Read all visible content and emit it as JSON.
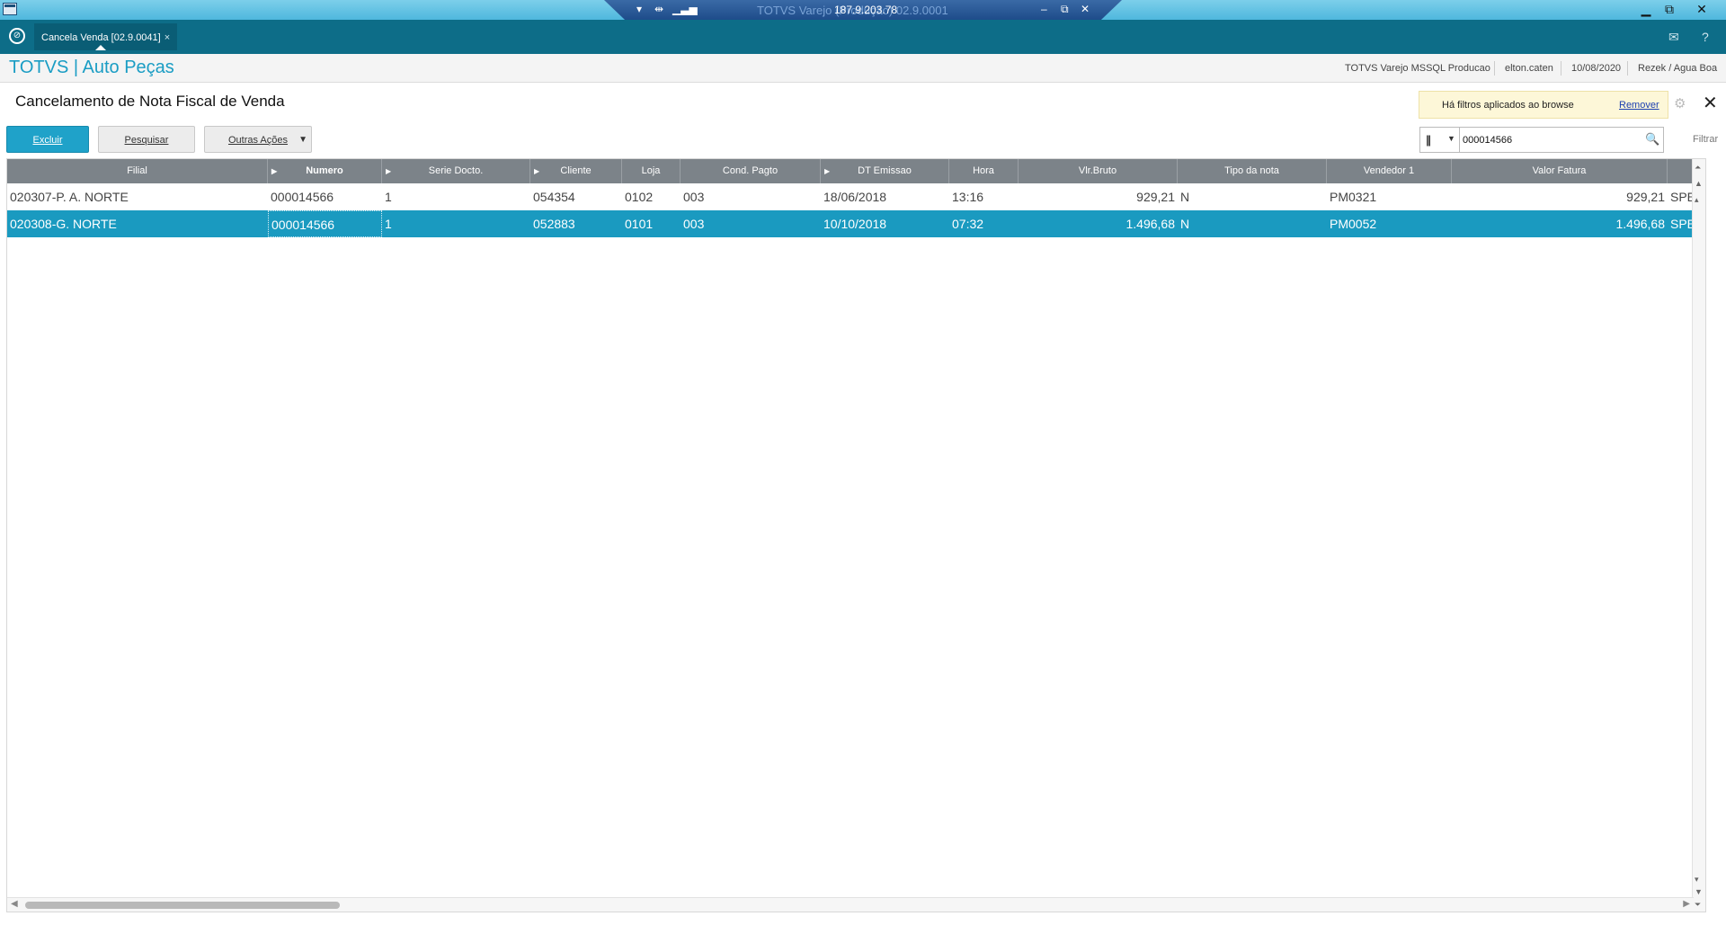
{
  "remote_bar": {
    "ghost_title": "TOTVS Varejo (Produção) 02.9.0001",
    "ip": "187.9.203.78"
  },
  "tab": {
    "label": "Cancela Venda [02.9.0041]",
    "close": "×"
  },
  "header": {
    "brand": "TOTVS | Auto Peças",
    "environment": "TOTVS Varejo MSSQL Producao",
    "user": "elton.caten",
    "date": "10/08/2020",
    "company": "Rezek / Agua Boa"
  },
  "page": {
    "title": "Cancelamento de Nota Fiscal de Venda"
  },
  "filter_notice": {
    "text": "Há filtros aplicados ao browse",
    "remove": "Remover"
  },
  "toolbar": {
    "excluir": "Excluir",
    "pesquisar": "Pesquisar",
    "outras_acoes": "Outras Ações"
  },
  "search": {
    "value": "000014566",
    "filter_label": "Filtrar"
  },
  "columns": [
    "Filial",
    "Numero",
    "Serie Docto.",
    "Cliente",
    "Loja",
    "Cond. Pagto",
    "DT Emissao",
    "Hora",
    "Vlr.Bruto",
    "Tipo da nota",
    "Vendedor 1",
    "Valor Fatura",
    ""
  ],
  "rows": [
    [
      "020307-P. A. NORTE",
      "000014566",
      "1",
      "054354",
      "0102",
      "003",
      "18/06/2018",
      "13:16",
      "929,21",
      "N",
      "PM0321",
      "929,21",
      "SPED"
    ],
    [
      "020308-G. NORTE",
      "000014566",
      "1",
      "052883",
      "0101",
      "003",
      "10/10/2018",
      "07:32",
      "1.496,68",
      "N",
      "PM0052",
      "1.496,68",
      "SPED"
    ]
  ],
  "colors": {
    "header_teal": "#0d6d88",
    "accent": "#1fa2c9",
    "selected_row": "#1a9ac0",
    "grid_header": "#7c8389"
  }
}
